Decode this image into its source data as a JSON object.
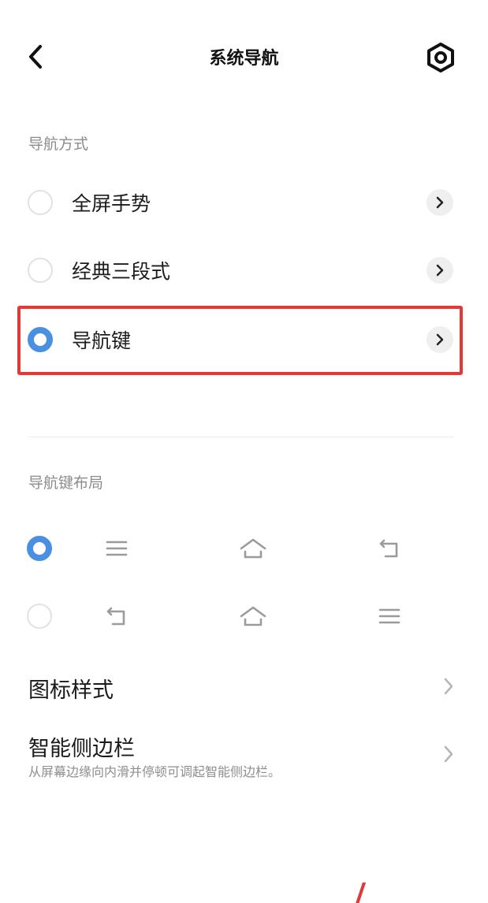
{
  "header": {
    "title": "系统导航",
    "back_icon": "chevron-left-icon",
    "settings_icon": "hexagon-settings-icon"
  },
  "navigation_mode": {
    "section_label": "导航方式",
    "options": [
      {
        "label": "全屏手势",
        "selected": false
      },
      {
        "label": "经典三段式",
        "selected": false
      },
      {
        "label": "导航键",
        "selected": true
      }
    ],
    "highlight_color": "#e03a37",
    "accent_color": "#4a90e2"
  },
  "key_layout": {
    "section_label": "导航键布局",
    "rows": [
      {
        "selected": true,
        "keys": [
          "menu-icon",
          "home-icon",
          "back-icon"
        ]
      },
      {
        "selected": false,
        "keys": [
          "back-icon",
          "home-icon",
          "menu-icon"
        ]
      }
    ]
  },
  "icon_style": {
    "title": "图标样式"
  },
  "smart_sidebar": {
    "title": "智能侧边栏",
    "subtitle": "从屏幕边缘向内滑并停顿可调起智能侧边栏。"
  }
}
